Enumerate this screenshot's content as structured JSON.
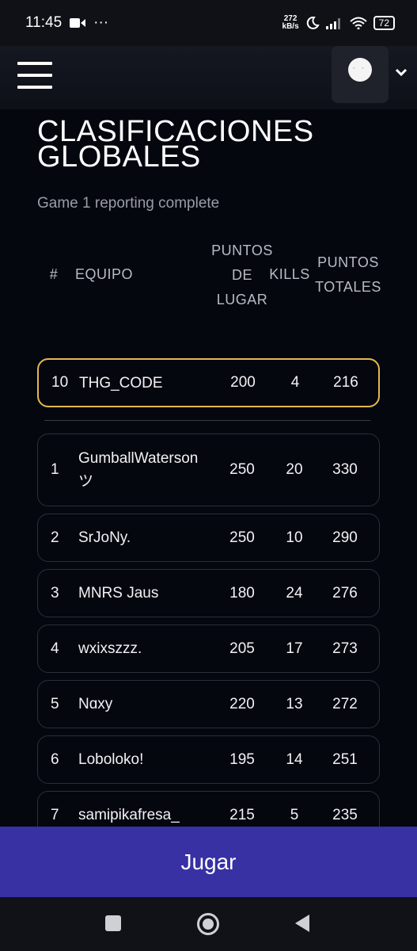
{
  "status_bar": {
    "time": "11:45",
    "more": "···",
    "net_speed_value": "272",
    "net_speed_unit": "kB/s",
    "battery": "72"
  },
  "page": {
    "title": "CLASIFICACIONES GLOBALES",
    "subtitle": "Game 1 reporting complete"
  },
  "table": {
    "headers": {
      "rank": "#",
      "team": "EQUIPO",
      "place_points": "PUNTOS DE LUGAR",
      "kills": "KILLS",
      "total_points": "PUNTOS TOTALES"
    },
    "my_row": {
      "rank": "10",
      "team": "THG_CODE",
      "place_points": "200",
      "kills": "4",
      "total": "216"
    },
    "rows": [
      {
        "rank": "1",
        "team": "GumballWaterson ツ",
        "place_points": "250",
        "kills": "20",
        "total": "330"
      },
      {
        "rank": "2",
        "team": "SrJoNy.",
        "place_points": "250",
        "kills": "10",
        "total": "290"
      },
      {
        "rank": "3",
        "team": "MNRS Jaus",
        "place_points": "180",
        "kills": "24",
        "total": "276"
      },
      {
        "rank": "4",
        "team": "wxixszzz.",
        "place_points": "205",
        "kills": "17",
        "total": "273"
      },
      {
        "rank": "5",
        "team": "Nɑxy",
        "place_points": "220",
        "kills": "13",
        "total": "272"
      },
      {
        "rank": "6",
        "team": "Loboloko!",
        "place_points": "195",
        "kills": "14",
        "total": "251"
      },
      {
        "rank": "7",
        "team": "samipikafresa_",
        "place_points": "215",
        "kills": "5",
        "total": "235"
      }
    ]
  },
  "play_button": {
    "label": "Jugar"
  },
  "colors": {
    "highlight": "#e3b94f",
    "play": "#3731a4",
    "background": "#05070f"
  },
  "icons": [
    "video-icon",
    "moon-icon",
    "signal-icon",
    "wifi-icon",
    "battery-icon",
    "menu-icon",
    "avatar",
    "chevron-down-icon",
    "recents-icon",
    "home-icon",
    "back-icon"
  ]
}
